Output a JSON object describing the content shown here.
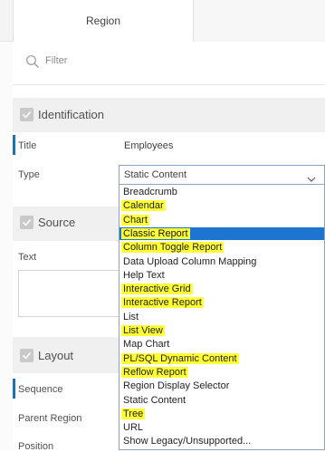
{
  "tabs": {
    "region": "Region"
  },
  "filter": {
    "placeholder": "Filter",
    "icon": "search-icon"
  },
  "groups": {
    "identification": "Identification",
    "source": "Source",
    "layout": "Layout"
  },
  "identification": {
    "title_label": "Title",
    "title_value": "Employees",
    "type_label": "Type",
    "type_value": "Static Content"
  },
  "source": {
    "text_label": "Text"
  },
  "layout": {
    "sequence_label": "Sequence",
    "parent_region_label": "Parent Region",
    "position_label": "Position"
  },
  "type_options": [
    {
      "label": "Breadcrumb",
      "highlighted": false,
      "selected": false
    },
    {
      "label": "Calendar",
      "highlighted": true,
      "selected": false
    },
    {
      "label": "Chart",
      "highlighted": true,
      "selected": false
    },
    {
      "label": "Classic Report",
      "highlighted": true,
      "selected": true
    },
    {
      "label": "Column Toggle Report",
      "highlighted": true,
      "selected": false
    },
    {
      "label": "Data Upload Column Mapping",
      "highlighted": false,
      "selected": false
    },
    {
      "label": "Help Text",
      "highlighted": false,
      "selected": false
    },
    {
      "label": "Interactive Grid",
      "highlighted": true,
      "selected": false
    },
    {
      "label": "Interactive Report",
      "highlighted": true,
      "selected": false
    },
    {
      "label": "List",
      "highlighted": false,
      "selected": false
    },
    {
      "label": "List View",
      "highlighted": true,
      "selected": false
    },
    {
      "label": "Map Chart",
      "highlighted": false,
      "selected": false
    },
    {
      "label": "PL/SQL Dynamic Content",
      "highlighted": true,
      "selected": false
    },
    {
      "label": "Reflow Report",
      "highlighted": true,
      "selected": false
    },
    {
      "label": "Region Display Selector",
      "highlighted": false,
      "selected": false
    },
    {
      "label": "Static Content",
      "highlighted": false,
      "selected": false
    },
    {
      "label": "Tree",
      "highlighted": true,
      "selected": false
    },
    {
      "label": "URL",
      "highlighted": false,
      "selected": false
    },
    {
      "label": "Show Legacy/Unsupported...",
      "highlighted": false,
      "selected": false
    }
  ],
  "colors": {
    "highlight": "#ffff33",
    "selected_bg": "#1e74d1",
    "accent_bar": "#1a73b8"
  }
}
